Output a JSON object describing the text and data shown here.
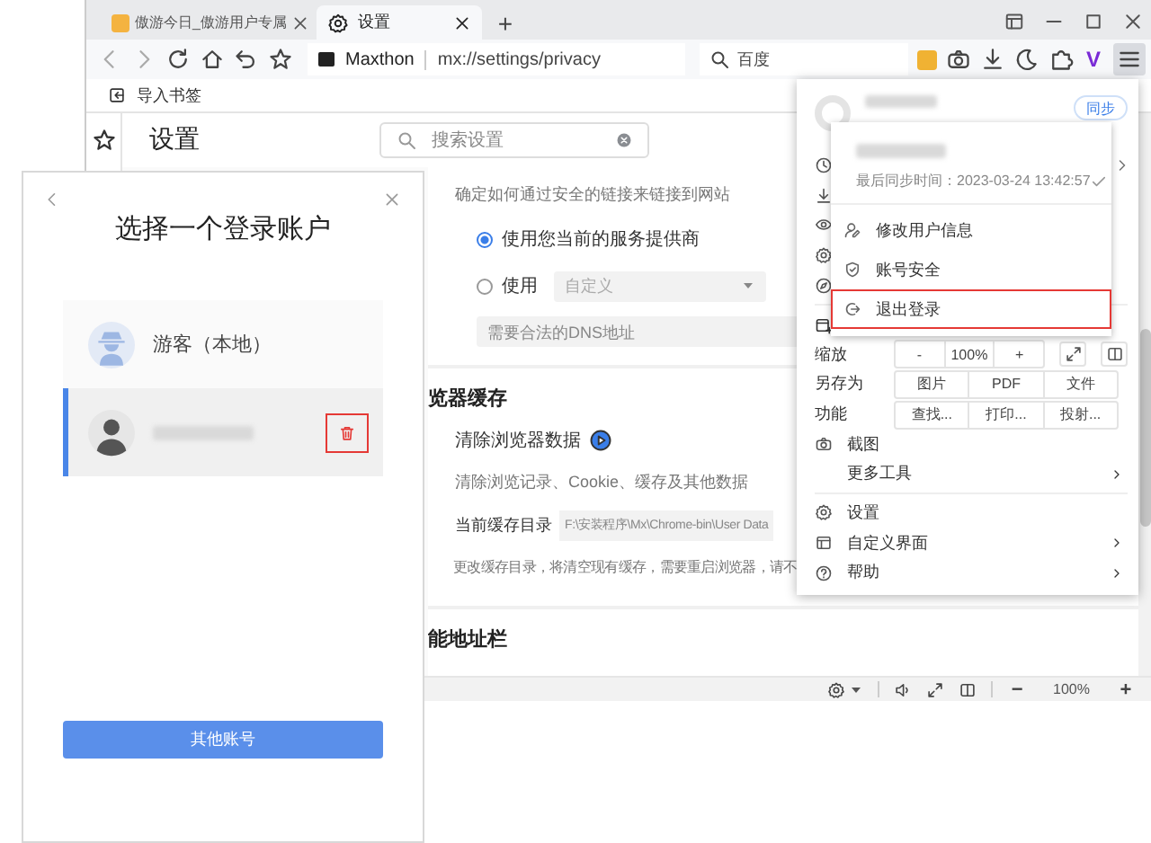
{
  "browser": {
    "tabs": [
      {
        "title": "傲游今日_傲游用户专属",
        "selected": false
      },
      {
        "title": "设置",
        "selected": true
      }
    ],
    "new_tab": "+",
    "brand": "Maxthon",
    "url": "mx://settings/privacy",
    "search_engine": "百度",
    "extension_badge": "V",
    "bookmarks": [
      "导入书签"
    ]
  },
  "settings": {
    "title": "设置",
    "search_placeholder": "搜索设置",
    "dns_hint": "确定如何通过安全的链接来链接到网站",
    "dns_options": [
      {
        "label": "使用您当前的服务提供商",
        "selected": true
      },
      {
        "label": "使用",
        "selected": false,
        "dropdown": "自定义"
      }
    ],
    "dns_placeholder": "需要合法的DNS地址",
    "cache_heading": "览器缓存",
    "clear_label": "清除浏览器数据",
    "clear_hint": "清除浏览记录、Cookie、缓存及其他数据",
    "dir_label": "当前缓存目录",
    "dir_value": "F:\\安装程序\\Mx\\Chrome-bin\\User Data",
    "dir_hint": "更改缓存目录，将清空现有缓存，需要重启浏览器，请不",
    "next_heading": "能地址栏"
  },
  "status_bar": {
    "zoom_out": "−",
    "zoom": "100%",
    "zoom_in": "+"
  },
  "main_menu": {
    "sync_button": "同步",
    "zoom_row": {
      "label": "缩放",
      "minus": "-",
      "value": "100%",
      "plus": "+"
    },
    "button_rows": [
      {
        "label": "另存为",
        "buttons": [
          "图片",
          "PDF",
          "文件"
        ]
      },
      {
        "label": "功能",
        "buttons": [
          "查找...",
          "打印...",
          "投射..."
        ]
      }
    ],
    "items": [
      {
        "label": "截图",
        "submenu": false,
        "divider_before": false
      },
      {
        "label": "更多工具",
        "submenu": true,
        "divider_before": false
      },
      {
        "label": "设置",
        "submenu": false,
        "divider_before": true
      },
      {
        "label": "自定义界面",
        "submenu": true,
        "divider_before": false
      },
      {
        "label": "帮助",
        "submenu": true,
        "divider_before": false
      }
    ]
  },
  "account_menu": {
    "last_sync": "最后同步时间：2023-03-24 13:42:57",
    "synced": true,
    "items": [
      {
        "label": "修改用户信息",
        "highlighted": false
      },
      {
        "label": "账号安全",
        "highlighted": false
      },
      {
        "label": "退出登录",
        "highlighted": true
      }
    ]
  },
  "dialog": {
    "title": "选择一个登录账户",
    "accounts": [
      {
        "kind": "guest",
        "name": "游客（本地）",
        "selected": false
      },
      {
        "kind": "user",
        "selected": true,
        "delete_highlighted": true
      }
    ],
    "other_button": "其他账号"
  }
}
